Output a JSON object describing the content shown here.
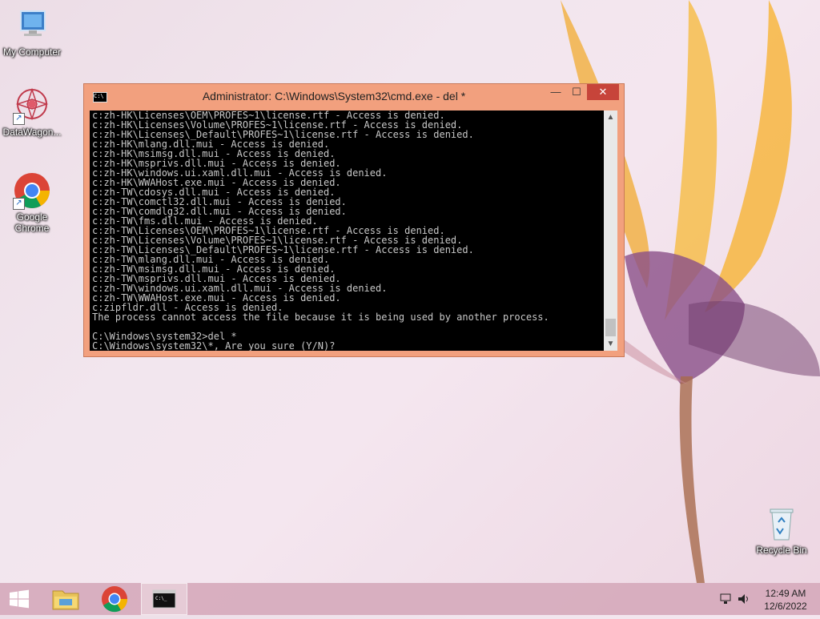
{
  "desktop": {
    "icons": [
      {
        "label": "My Computer"
      },
      {
        "label": "DataWagon..."
      },
      {
        "label": "Google Chrome"
      },
      {
        "label": "Recycle Bin"
      }
    ]
  },
  "cmd_window": {
    "title": "Administrator: C:\\Windows\\System32\\cmd.exe - del  *",
    "buttons": {
      "minimize": "—",
      "maximize": "☐",
      "close": "✕"
    },
    "lines": [
      "c:zh-HK\\Licenses\\OEM\\PROFES~1\\license.rtf - Access is denied.",
      "c:zh-HK\\Licenses\\Volume\\PROFES~1\\license.rtf - Access is denied.",
      "c:zh-HK\\Licenses\\_Default\\PROFES~1\\license.rtf - Access is denied.",
      "c:zh-HK\\mlang.dll.mui - Access is denied.",
      "c:zh-HK\\msimsg.dll.mui - Access is denied.",
      "c:zh-HK\\msprivs.dll.mui - Access is denied.",
      "c:zh-HK\\windows.ui.xaml.dll.mui - Access is denied.",
      "c:zh-HK\\WWAHost.exe.mui - Access is denied.",
      "c:zh-TW\\cdosys.dll.mui - Access is denied.",
      "c:zh-TW\\comctl32.dll.mui - Access is denied.",
      "c:zh-TW\\comdlg32.dll.mui - Access is denied.",
      "c:zh-TW\\fms.dll.mui - Access is denied.",
      "c:zh-TW\\Licenses\\OEM\\PROFES~1\\license.rtf - Access is denied.",
      "c:zh-TW\\Licenses\\Volume\\PROFES~1\\license.rtf - Access is denied.",
      "c:zh-TW\\Licenses\\_Default\\PROFES~1\\license.rtf - Access is denied.",
      "c:zh-TW\\mlang.dll.mui - Access is denied.",
      "c:zh-TW\\msimsg.dll.mui - Access is denied.",
      "c:zh-TW\\msprivs.dll.mui - Access is denied.",
      "c:zh-TW\\windows.ui.xaml.dll.mui - Access is denied.",
      "c:zh-TW\\WWAHost.exe.mui - Access is denied.",
      "c:zipfldr.dll - Access is denied.",
      "The process cannot access the file because it is being used by another process.",
      "",
      "C:\\Windows\\system32>del *",
      "C:\\Windows\\system32\\*, Are you sure (Y/N)?"
    ]
  },
  "taskbar": {
    "clock_time": "12:49 AM",
    "clock_date": "12/6/2022"
  }
}
